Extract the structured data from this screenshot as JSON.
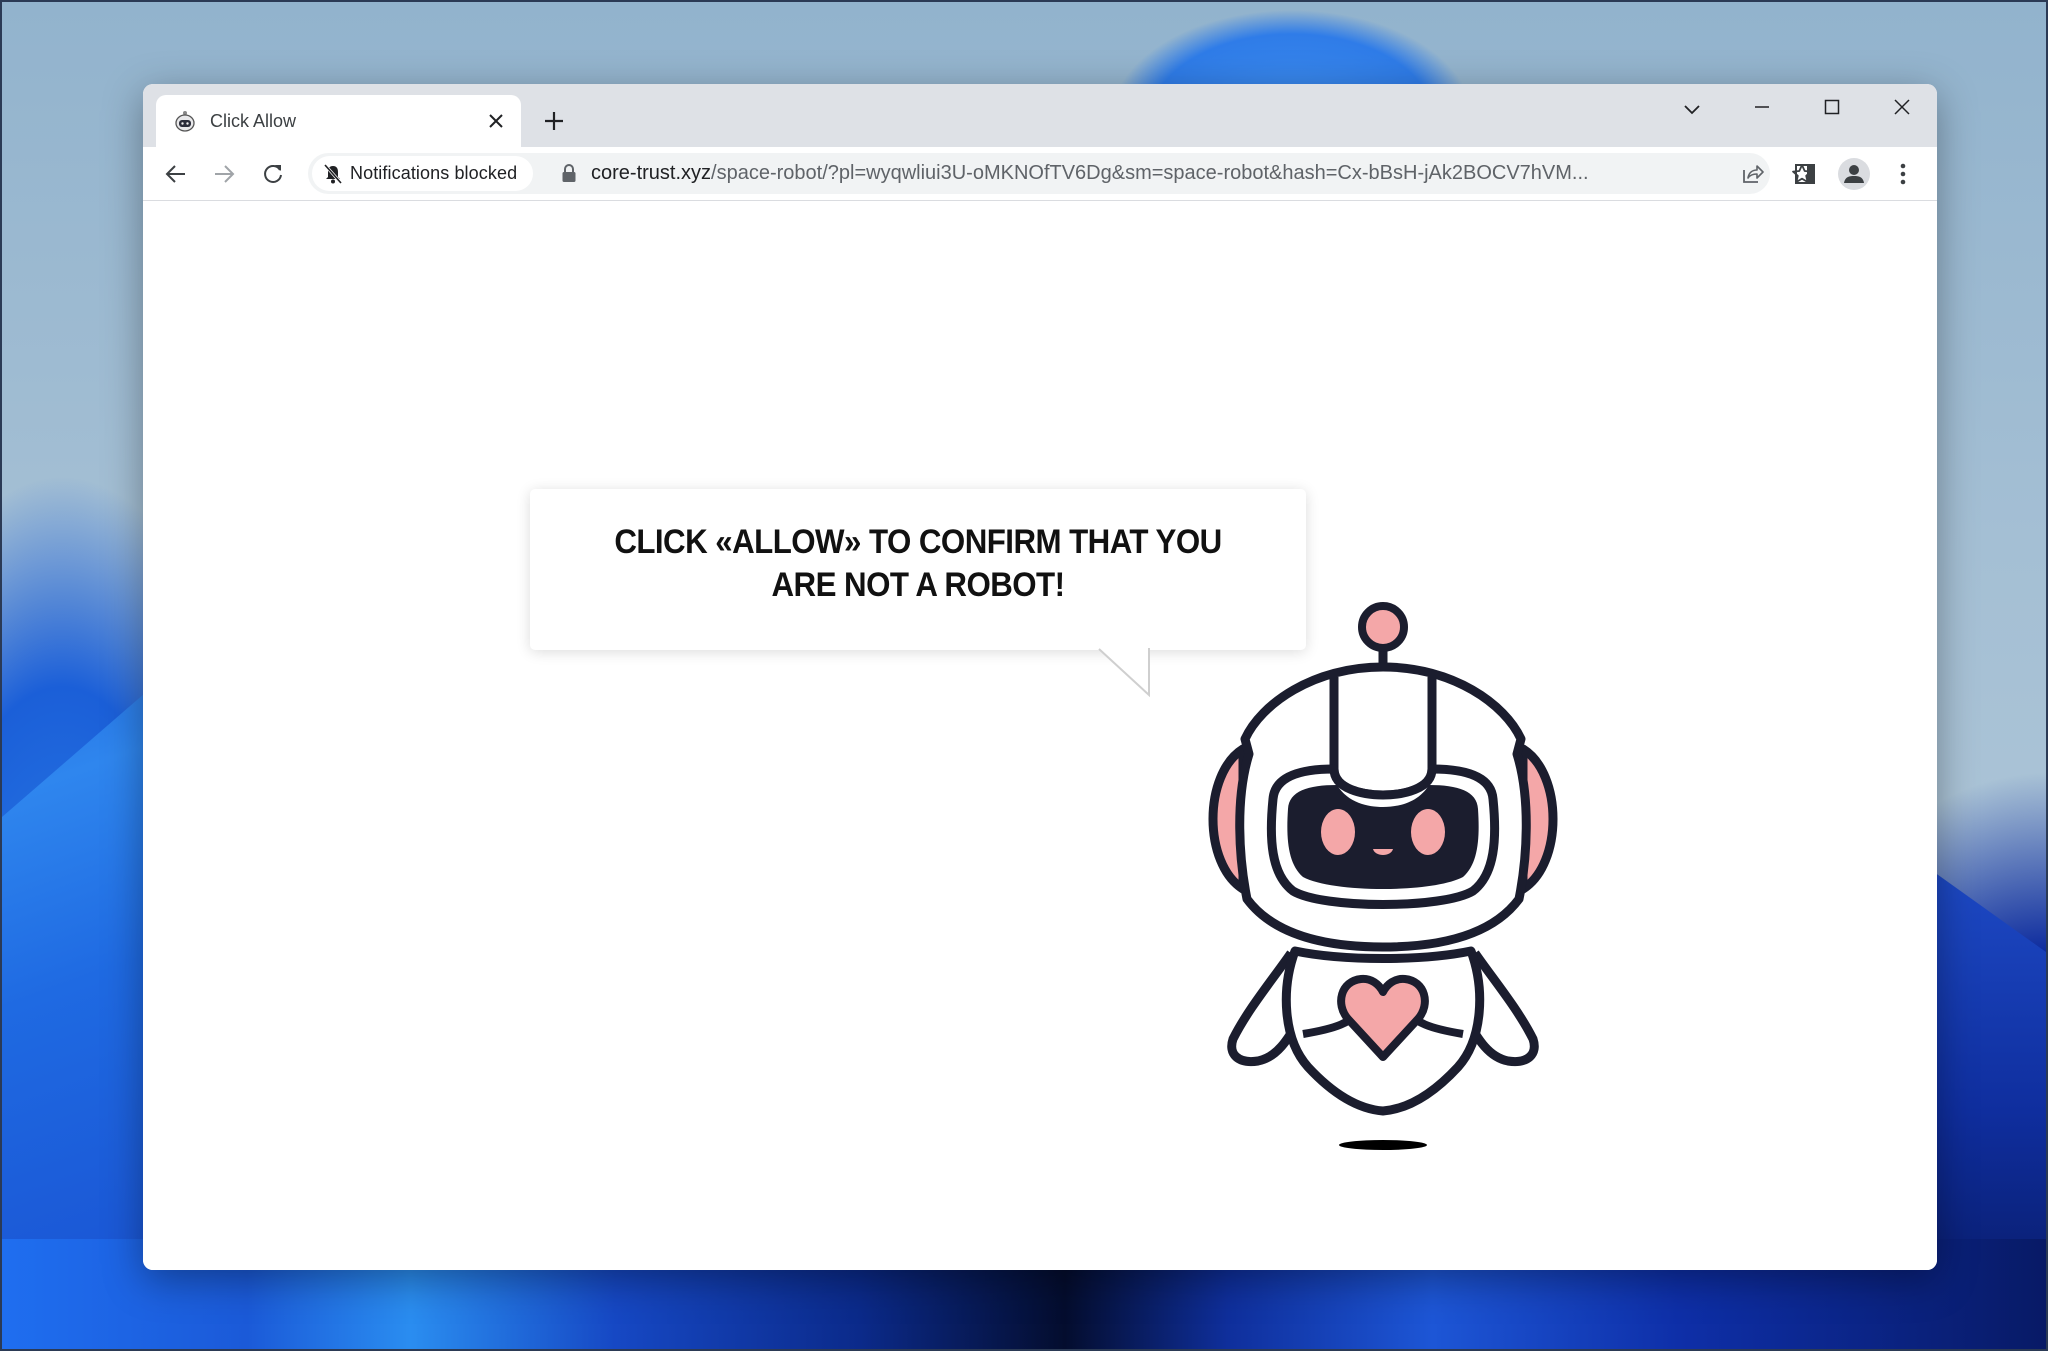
{
  "browser": {
    "tab": {
      "title": "Click Allow",
      "favicon": "robot-favicon-icon",
      "close_icon": "close-icon"
    },
    "new_tab_icon": "plus-icon",
    "window_controls": [
      "tab-search-icon",
      "minimize-icon",
      "maximize-icon",
      "close-icon"
    ],
    "nav": {
      "back_icon": "arrow-left-icon",
      "forward_icon": "arrow-right-icon",
      "reload_icon": "reload-icon"
    },
    "omnibox": {
      "chip_label": "Notifications blocked",
      "chip_icon": "bell-off-icon",
      "lock_icon": "lock-icon",
      "url_host": "core-trust.xyz",
      "url_rest": "/space-robot/?pl=wyqwliui3U-oMKNOfTV6Dg&sm=space-robot&hash=Cx-bBsH-jAk2BOCV7hVM...",
      "share_icon": "share-icon",
      "bookmark_icon": "star-icon"
    },
    "toolbar_right": [
      "side-panel-icon",
      "profile-avatar-icon",
      "kebab-menu-icon"
    ]
  },
  "page": {
    "bubble_text": "CLICK «ALLOW» TO CONFIRM THAT YOU ARE NOT A ROBOT!",
    "illustration": "robot-mascot",
    "colors": {
      "outline": "#1b1d2e",
      "accent_pink": "#f4a7a8",
      "visor": "#1b1d2e"
    }
  }
}
